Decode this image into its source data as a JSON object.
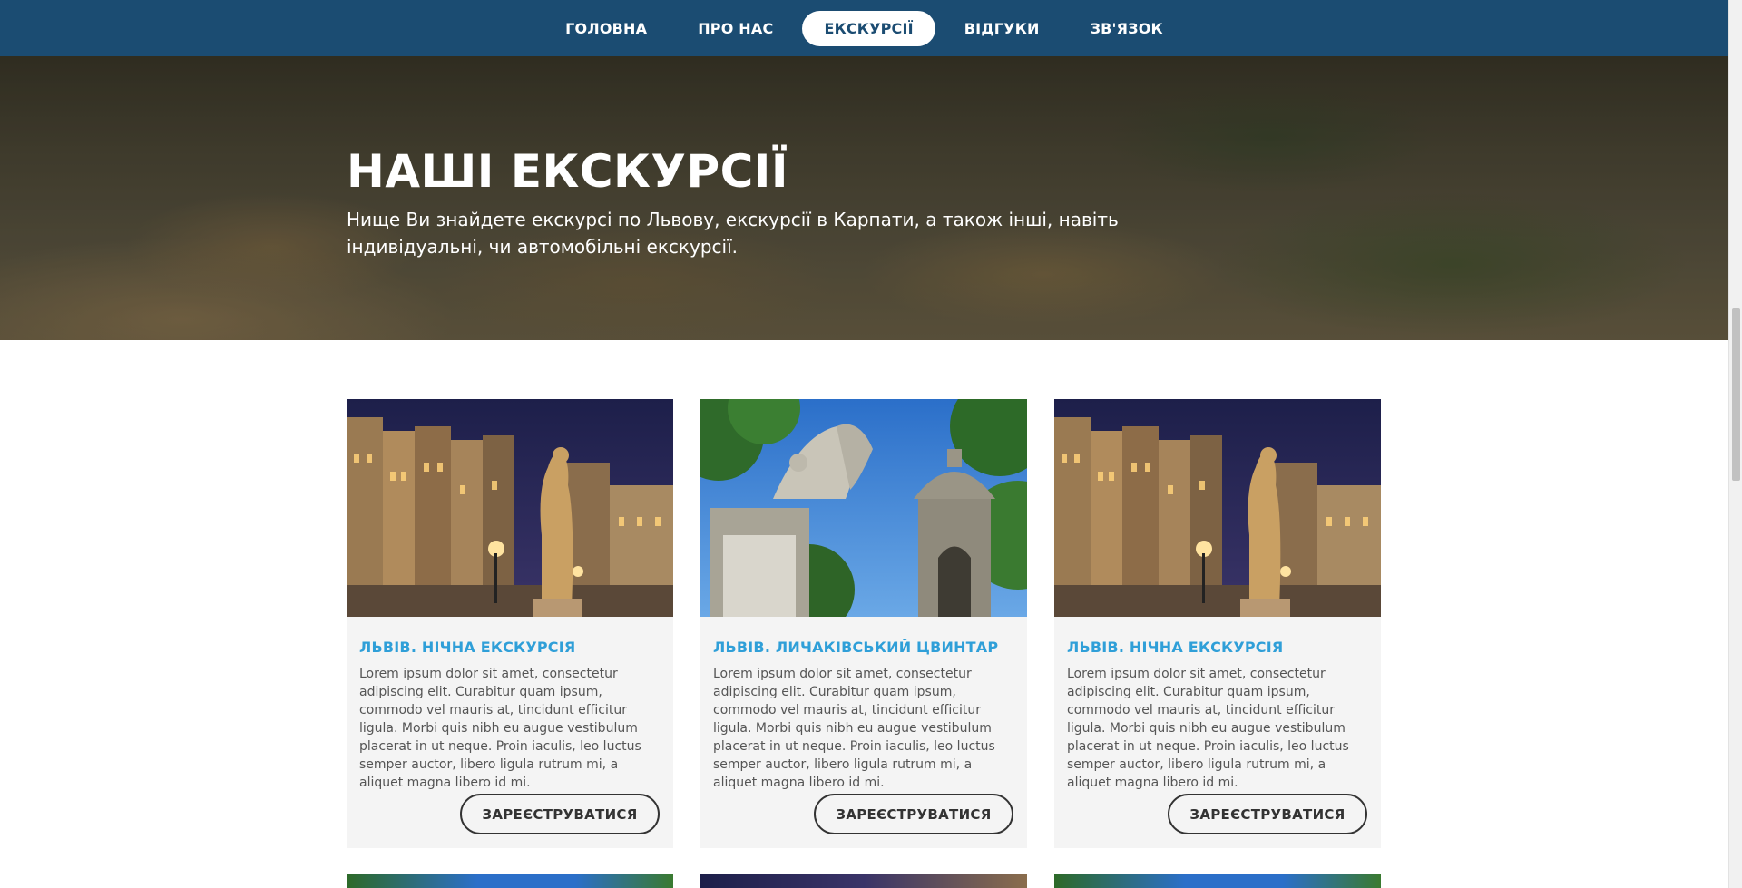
{
  "nav": {
    "items": [
      {
        "label": "ГОЛОВНА",
        "active": false
      },
      {
        "label": "ПРО НАС",
        "active": false
      },
      {
        "label": "ЕКСКУРСІЇ",
        "active": true
      },
      {
        "label": "ВІДГУКИ",
        "active": false
      },
      {
        "label": "ЗВ'ЯЗОК",
        "active": false
      }
    ]
  },
  "hero": {
    "title": "НАШІ ЕКСКУРСІЇ",
    "subtitle": "Нище Ви знайдете екскурсі по Львову, екскурсії в Карпати, а також інші, навіть індивідуальні, чи автомобільні екскурсії."
  },
  "tours": [
    {
      "title": "ЛЬВІВ. НІЧНА ЕКСКУРСІЯ",
      "text": "Lorem ipsum dolor sit amet, consectetur adipiscing elit. Curabitur quam ipsum, commodo vel mauris at, tincidunt efficitur ligula. Morbi quis nibh eu augue vestibulum placerat in ut neque. Proin iaculis, leo luctus semper auctor, libero ligula rutrum mi, a aliquet magna libero id mi.",
      "button": "ЗАРЕЄСТРУВАТИСЯ",
      "image": "night-square-statue"
    },
    {
      "title": "ЛЬВІВ. ЛИЧАКІВСЬКИЙ ЦВИНТАР",
      "text": "Lorem ipsum dolor sit amet, consectetur adipiscing elit. Curabitur quam ipsum, commodo vel mauris at, tincidunt efficitur ligula. Morbi quis nibh eu augue vestibulum placerat in ut neque. Proin iaculis, leo luctus semper auctor, libero ligula rutrum mi, a aliquet magna libero id mi.",
      "button": "ЗАРЕЄСТРУВАТИСЯ",
      "image": "cemetery-angel-chapel"
    },
    {
      "title": "ЛЬВІВ. НІЧНА ЕКСКУРСІЯ",
      "text": "Lorem ipsum dolor sit amet, consectetur adipiscing elit. Curabitur quam ipsum, commodo vel mauris at, tincidunt efficitur ligula. Morbi quis nibh eu augue vestibulum placerat in ut neque. Proin iaculis, leo luctus semper auctor, libero ligula rutrum mi, a aliquet magna libero id mi.",
      "button": "ЗАРЕЄСТРУВАТИСЯ",
      "image": "night-square-statue"
    }
  ],
  "colors": {
    "nav_bg": "#1b4c72",
    "accent": "#2f9fd8",
    "card_bg": "#f4f4f4"
  }
}
